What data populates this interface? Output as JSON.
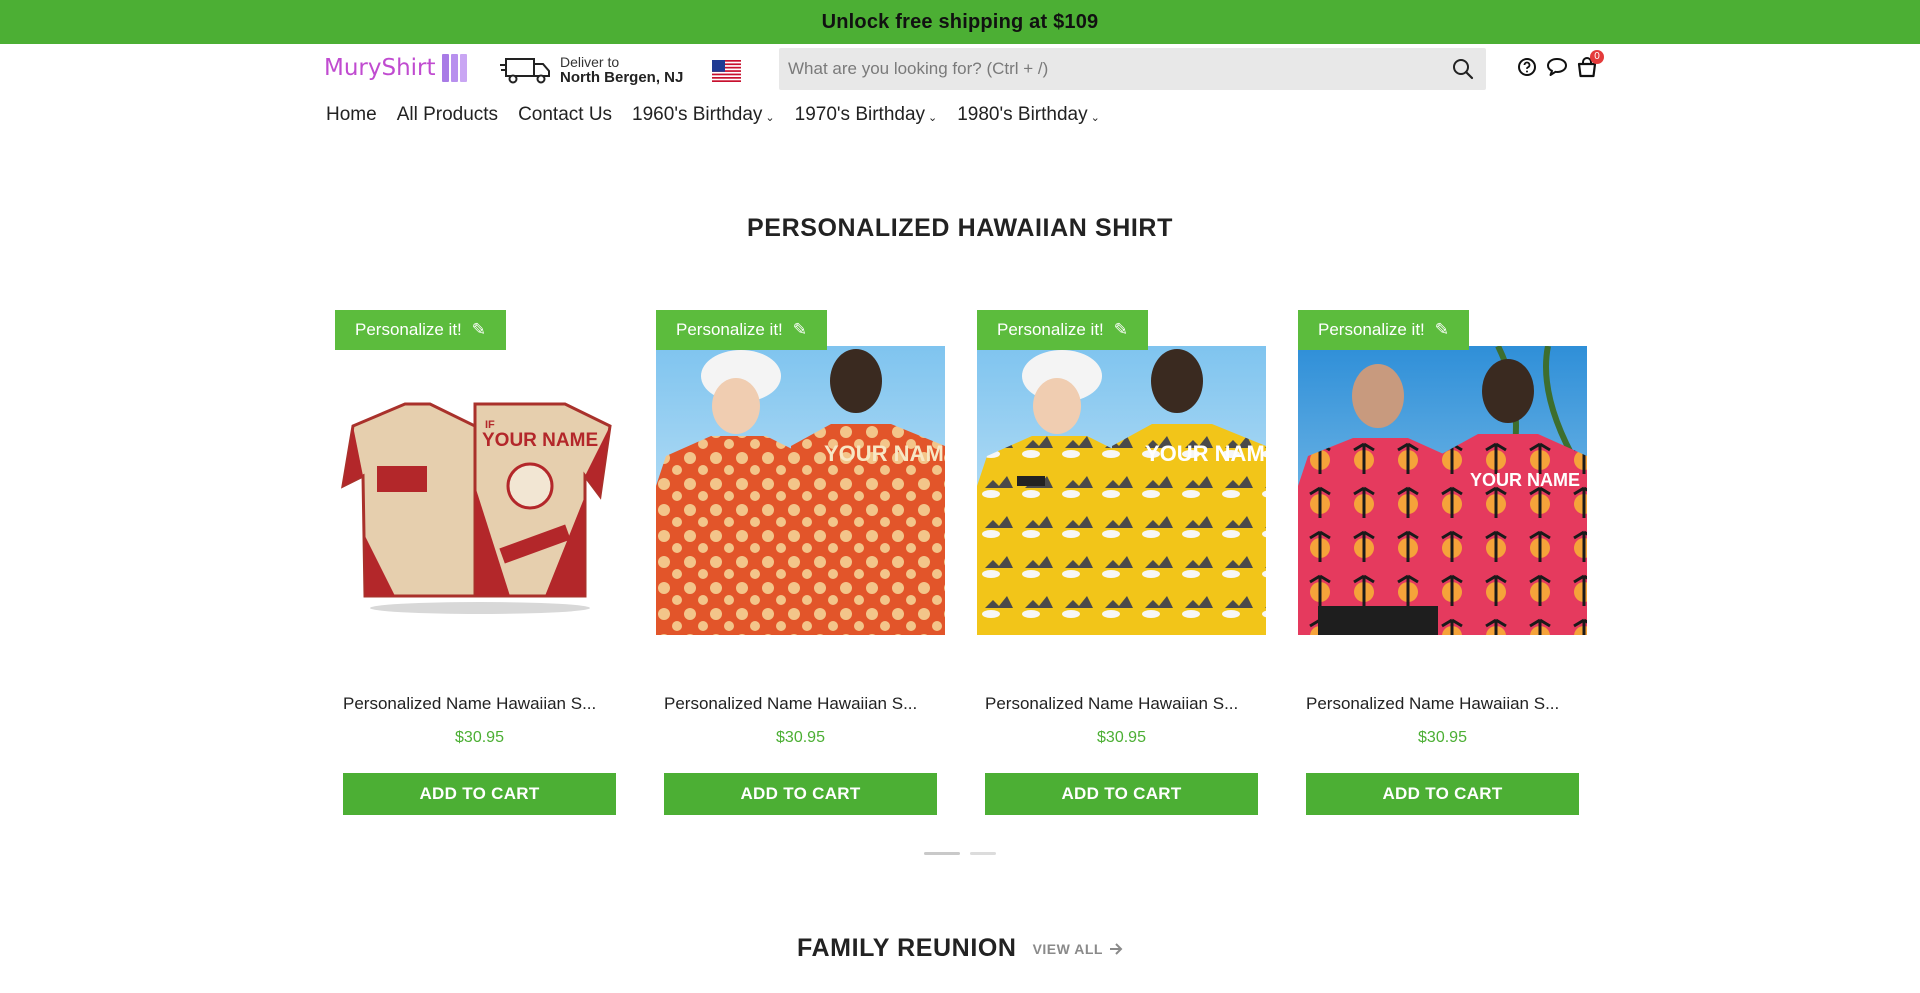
{
  "promo": {
    "text": "Unlock free shipping at $109"
  },
  "header": {
    "logo_text": "MuryShirt",
    "deliver_label": "Deliver to",
    "deliver_location": "North Bergen, NJ",
    "search_placeholder": "What are you looking for? (Ctrl + /)",
    "cart_count": "0"
  },
  "nav": {
    "items": [
      {
        "label": "Home"
      },
      {
        "label": "All Products"
      },
      {
        "label": "Contact Us"
      },
      {
        "label": "1960's Birthday"
      },
      {
        "label": "1970's Birthday"
      },
      {
        "label": "1980's Birthday"
      }
    ]
  },
  "section": {
    "title": "PERSONALIZED HAWAIIAN SHIRT"
  },
  "products": [
    {
      "badge": "Personalize it!",
      "name": "Personalized Name Hawaiian S...",
      "price": "$30.95",
      "button": "ADD TO CART",
      "image_text": "YOUR NAME"
    },
    {
      "badge": "Personalize it!",
      "name": "Personalized Name Hawaiian S...",
      "price": "$30.95",
      "button": "ADD TO CART",
      "image_text": "YOUR NAME"
    },
    {
      "badge": "Personalize it!",
      "name": "Personalized Name Hawaiian S...",
      "price": "$30.95",
      "button": "ADD TO CART",
      "image_text": "YOUR NAME"
    },
    {
      "badge": "Personalize it!",
      "name": "Personalized Name Hawaiian S...",
      "price": "$30.95",
      "button": "ADD TO CART",
      "image_text": "YOUR NAME"
    }
  ],
  "next_section": {
    "title": "FAMILY REUNION",
    "view_all": "VIEW ALL"
  },
  "colors": {
    "brand_green": "#4caf34",
    "badge_green": "#5cbc3d",
    "logo_purple": "#c04bd0"
  },
  "icons": [
    "truck-icon",
    "us-flag-icon",
    "search-icon",
    "help-icon",
    "chat-icon",
    "cart-icon",
    "pencil-icon",
    "chevron-down-icon",
    "arrow-right-icon"
  ]
}
